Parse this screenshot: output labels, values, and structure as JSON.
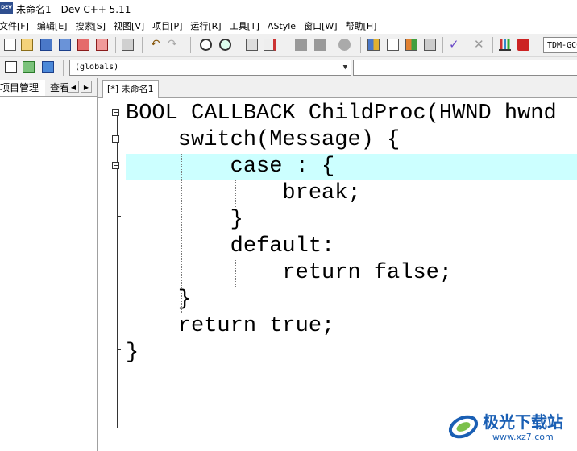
{
  "window": {
    "title": "未命名1 - Dev-C++ 5.11",
    "app_icon_label": "DEV"
  },
  "menu": [
    {
      "label": "文件[F]"
    },
    {
      "label": "编辑[E]"
    },
    {
      "label": "搜索[S]"
    },
    {
      "label": "视图[V]"
    },
    {
      "label": "项目[P]"
    },
    {
      "label": "运行[R]"
    },
    {
      "label": "工具[T]"
    },
    {
      "label": "AStyle"
    },
    {
      "label": "窗口[W]"
    },
    {
      "label": "帮助[H]"
    }
  ],
  "toolbar": {
    "compiler_value": "TDM-GCC"
  },
  "toolbar2": {
    "scope_select_value": "(globals)"
  },
  "left_panel": {
    "tabs": [
      {
        "label": "项目管理"
      },
      {
        "label": "查看类"
      }
    ]
  },
  "editor": {
    "file_tab": "[*] 未命名1",
    "highlight_color": "#ccffff",
    "code_lines": [
      "BOOL CALLBACK ChildProc(HWND hwnd",
      "    switch(Message) {",
      "        case : {",
      "            break;",
      "        }",
      "        default:",
      "            return false;",
      "    }",
      "    return true;",
      "}"
    ],
    "highlighted_line": 3
  },
  "watermark": {
    "name": "极光下载站",
    "url": "www.xz7.com"
  }
}
